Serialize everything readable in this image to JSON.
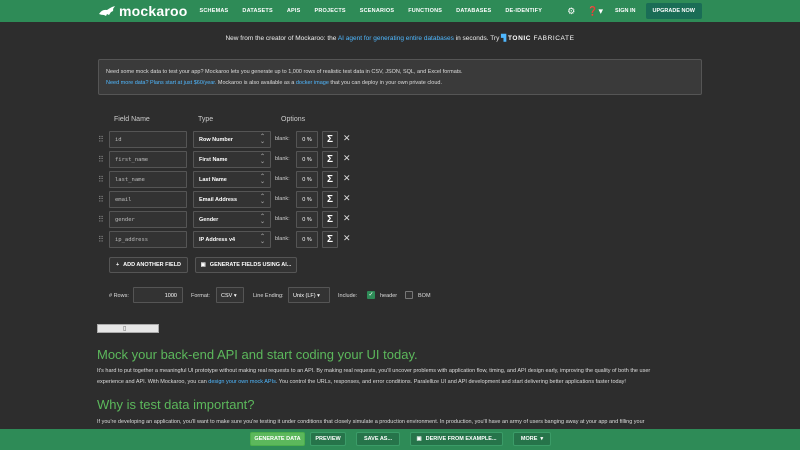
{
  "nav": {
    "brand": "mockaroo",
    "links": [
      "SCHEMAS",
      "DATASETS",
      "APIS",
      "PROJECTS",
      "SCENARIOS",
      "FUNCTIONS",
      "DATABASES",
      "DE-IDENTIFY"
    ],
    "signin": "SIGN IN",
    "upgrade": "UPGRADE NOW",
    "icons": [
      "gear-icon",
      "help-icon"
    ]
  },
  "banner": {
    "before": "New from the creator of Mockaroo: the ",
    "link": "AI agent for generating entire databases",
    "after": " in seconds. Try ",
    "tonic": "TONIC",
    "fabricate": " FABRICATE"
  },
  "info": {
    "line1": "Need some mock data to test your app? Mockaroo lets you generate up to 1,000 rows of realistic test data in CSV, JSON, SQL, and Excel formats.",
    "line2_link1": "Need more data? Plans start at just $60/year.",
    "line2_mid": " Mockaroo is also available as a ",
    "line2_link2": "docker image",
    "line2_end": " that you can deploy in your own private cloud."
  },
  "columns": {
    "field_name": "Field Name",
    "type": "Type",
    "options": "Options"
  },
  "fields": [
    {
      "name": "id",
      "type": "Row Number",
      "blank_label": "blank:",
      "blank": "0 %"
    },
    {
      "name": "first_name",
      "type": "First Name",
      "blank_label": "blank:",
      "blank": "0 %"
    },
    {
      "name": "last_name",
      "type": "Last Name",
      "blank_label": "blank:",
      "blank": "0 %"
    },
    {
      "name": "email",
      "type": "Email Address",
      "blank_label": "blank:",
      "blank": "0 %"
    },
    {
      "name": "gender",
      "type": "Gender",
      "blank_label": "blank:",
      "blank": "0 %"
    },
    {
      "name": "ip_address",
      "type": "IP Address v4",
      "blank_label": "blank:",
      "blank": "0 %"
    }
  ],
  "actions": {
    "add_field": "ADD ANOTHER FIELD",
    "generate_ai": "GENERATE FIELDS USING AI..."
  },
  "options": {
    "rows_label": "# Rows:",
    "rows": "1000",
    "format_label": "Format:",
    "format": "CSV",
    "line_ending_label": "Line Ending:",
    "line_ending": "Unix (LF)",
    "include_label": "Include:",
    "header_label": "header",
    "header_checked": true,
    "bom_label": "BOM",
    "bom_checked": false
  },
  "section1": {
    "title": "Mock your back-end API and start coding your UI today.",
    "p1": "It's hard to put together a meaningful UI prototype without making real requests to an API. By making real requests, you'll uncover problems with application flow, timing, and API design early, improving the quality of both the user",
    "p2_before": "experience and API. With Mockaroo, you can ",
    "p2_link": "design your own mock APIs",
    "p2_after": ". You control the URLs, responses, and error conditions. Paralellize UI and API development and start delivering better applications faster today!"
  },
  "section2": {
    "title": "Why is test data important?",
    "p1": "If you're developing an application, you'll want to make sure you're testing it under conditions that closely simulate a production environment. In production, you'll have an army of users banging away at your app and filling your"
  },
  "bottom": {
    "generate": "GENERATE DATA",
    "preview": "PREVIEW",
    "save": "SAVE AS...",
    "derive": "DERIVE FROM EXAMPLE...",
    "more": "MORE"
  },
  "colors": {
    "brand": "#2e8b57",
    "background": "#2d2d2d",
    "heading": "#5cb85c",
    "link": "#4fb8ff"
  }
}
